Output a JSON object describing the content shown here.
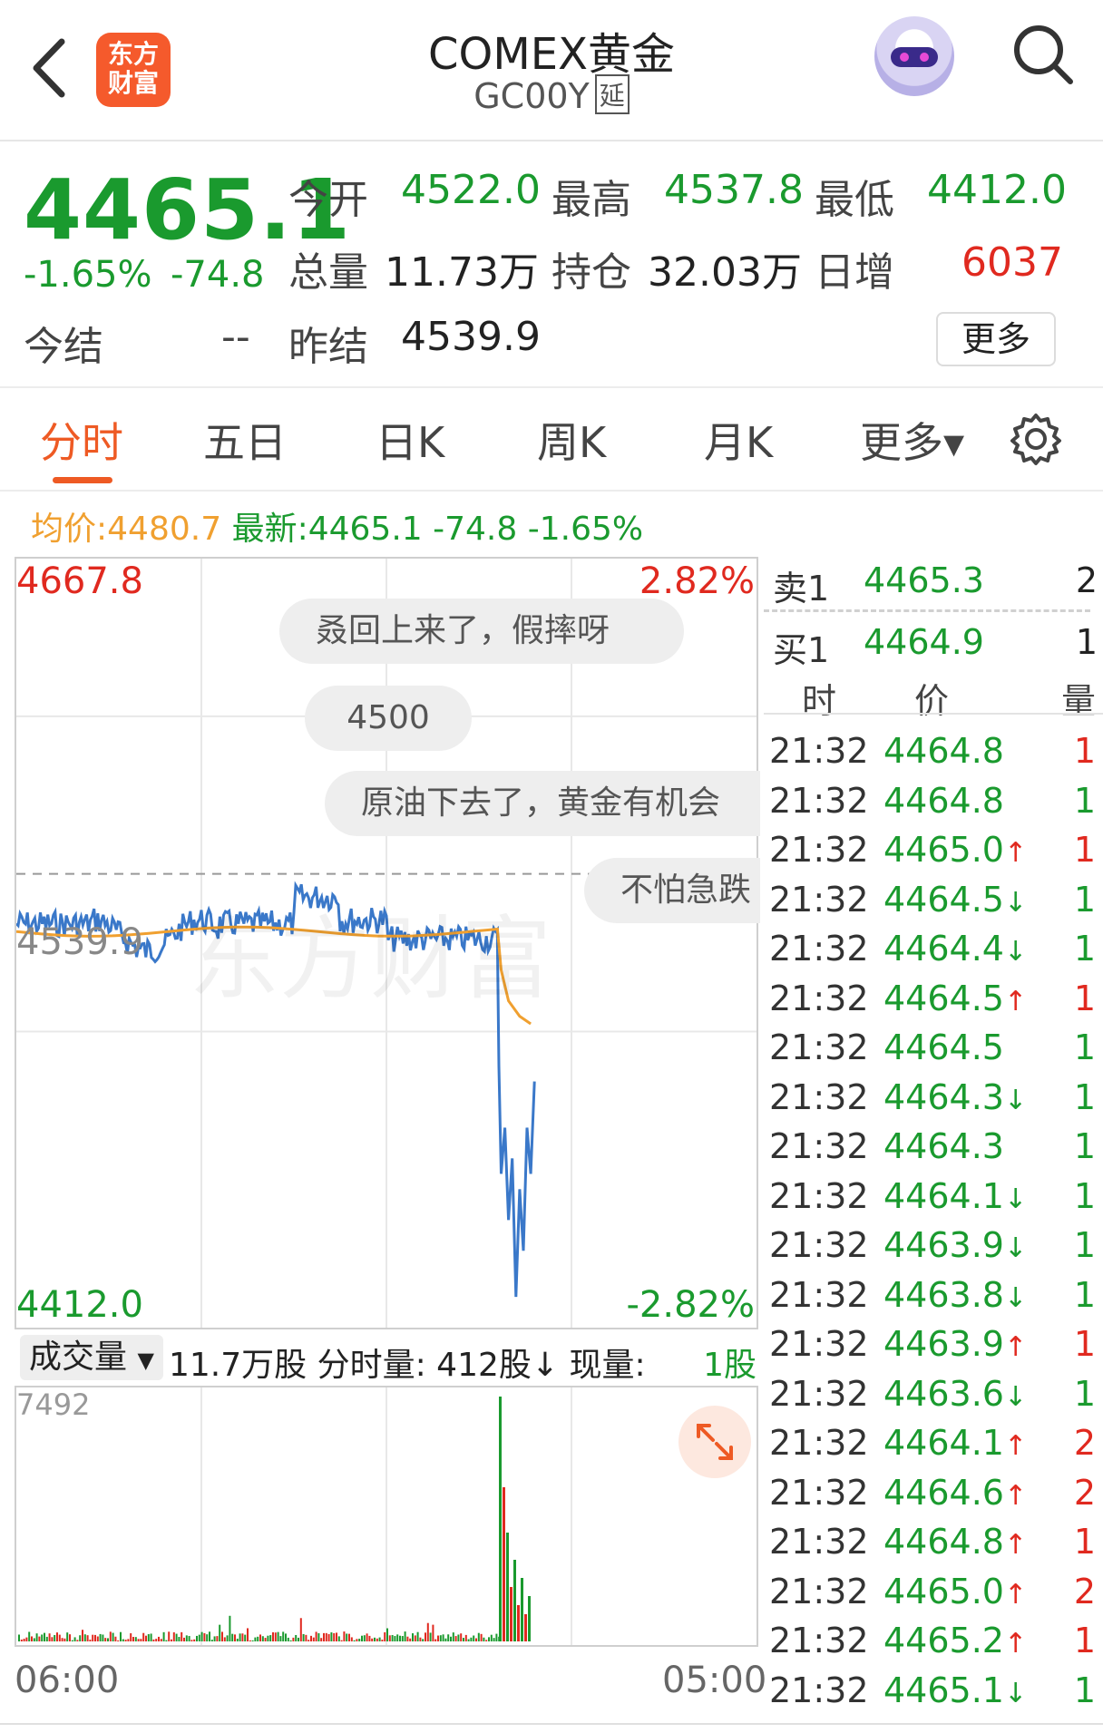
{
  "header": {
    "logo": "东方财富",
    "title": "COMEX黄金",
    "code": "GC00Y",
    "code_tag": "延"
  },
  "quote": {
    "price": "4465.1",
    "change_pct": "-1.65%",
    "change": "-74.8",
    "open_label": "今开",
    "open": "4522.0",
    "high_label": "最高",
    "high": "4537.8",
    "low_label": "最低",
    "low": "4412.0",
    "volume_label": "总量",
    "volume": "11.73万",
    "oi_label": "持仓",
    "oi": "32.03万",
    "daily_inc_label": "日增",
    "daily_inc": "6037",
    "settle_label": "今结",
    "settle": "--",
    "prev_settle_label": "昨结",
    "prev_settle": "4539.9",
    "more_button": "更多"
  },
  "tabs": [
    "分时",
    "五日",
    "日K",
    "周K",
    "月K",
    "更多▾"
  ],
  "info_line": {
    "avg_label": "均价:",
    "avg": "4480.7",
    "latest_label": "最新:",
    "latest": "4465.1",
    "latest_chg": "-74.8",
    "latest_pct": "-1.65%"
  },
  "chart_labels": {
    "top_price": "4667.8",
    "top_pct": "2.82%",
    "bottom_price": "4412.0",
    "bottom_pct": "-2.82%",
    "ref_price": "4539.9",
    "vol_max": "7492",
    "time_start": "06:00",
    "time_end": "05:00",
    "watermark": "东方财富"
  },
  "comments": [
    "叒回上来了，假摔呀",
    "4500",
    "原油下去了，黄金有机会",
    "不怕急跌"
  ],
  "volume_bar": {
    "selector": "成交量",
    "text": "11.7万股 分时量:  412股↓ 现量:",
    "current": "1股"
  },
  "order_book": {
    "sell": {
      "label": "卖1",
      "price": "4465.3",
      "qty": "2"
    },
    "buy": {
      "label": "买1",
      "price": "4464.9",
      "qty": "1"
    },
    "headers": [
      "时",
      "价",
      "量"
    ]
  },
  "trades": [
    {
      "time": "21:32",
      "price": "4464.8",
      "arrow": "",
      "qty": "1"
    },
    {
      "time": "21:32",
      "price": "4464.8",
      "arrow": "",
      "qty": "1"
    },
    {
      "time": "21:32",
      "price": "4465.0",
      "arrow": "↑",
      "qty": "1"
    },
    {
      "time": "21:32",
      "price": "4464.5",
      "arrow": "↓",
      "qty": "1"
    },
    {
      "time": "21:32",
      "price": "4464.4",
      "arrow": "↓",
      "qty": "1"
    },
    {
      "time": "21:32",
      "price": "4464.5",
      "arrow": "↑",
      "qty": "1"
    },
    {
      "time": "21:32",
      "price": "4464.5",
      "arrow": "",
      "qty": "1"
    },
    {
      "time": "21:32",
      "price": "4464.3",
      "arrow": "↓",
      "qty": "1"
    },
    {
      "time": "21:32",
      "price": "4464.3",
      "arrow": "",
      "qty": "1"
    },
    {
      "time": "21:32",
      "price": "4464.1",
      "arrow": "↓",
      "qty": "1"
    },
    {
      "time": "21:32",
      "price": "4463.9",
      "arrow": "↓",
      "qty": "1"
    },
    {
      "time": "21:32",
      "price": "4463.8",
      "arrow": "↓",
      "qty": "1"
    },
    {
      "time": "21:32",
      "price": "4463.9",
      "arrow": "↑",
      "qty": "1"
    },
    {
      "time": "21:32",
      "price": "4463.6",
      "arrow": "↓",
      "qty": "1"
    },
    {
      "time": "21:32",
      "price": "4464.1",
      "arrow": "↑",
      "qty": "2"
    },
    {
      "time": "21:32",
      "price": "4464.6",
      "arrow": "↑",
      "qty": "2"
    },
    {
      "time": "21:32",
      "price": "4464.8",
      "arrow": "↑",
      "qty": "1"
    },
    {
      "time": "21:32",
      "price": "4465.0",
      "arrow": "↑",
      "qty": "2"
    },
    {
      "time": "21:32",
      "price": "4465.2",
      "arrow": "↑",
      "qty": "1"
    },
    {
      "time": "21:32",
      "price": "4465.1",
      "arrow": "↓",
      "qty": "1"
    }
  ],
  "colors": {
    "up": "#e0291f",
    "down": "#1a9a2e",
    "accent": "#ee5a24",
    "price_line": "#3a78c9",
    "avg_line": "#f0a030"
  }
}
